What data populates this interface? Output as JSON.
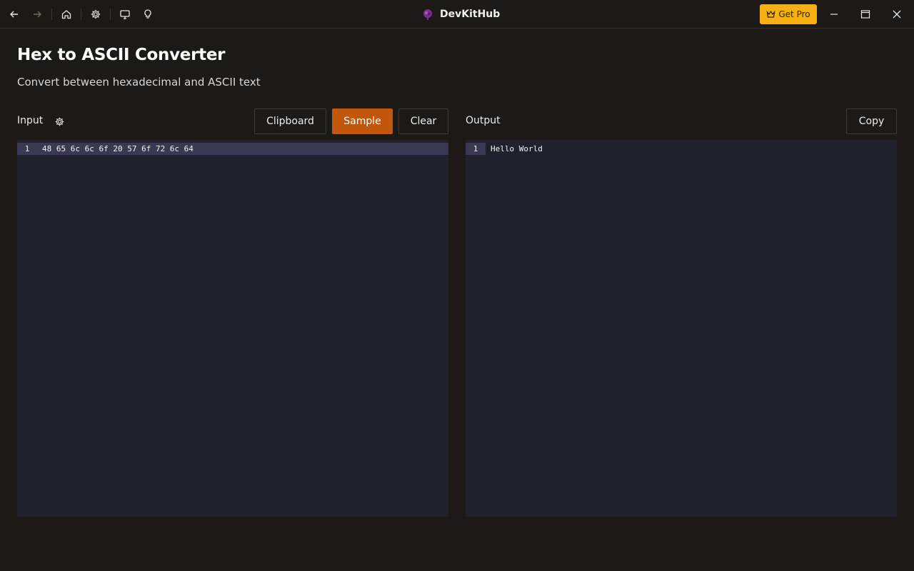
{
  "app": {
    "title": "DevKitHub",
    "get_pro_label": "Get Pro",
    "accent_color": "#f5b014"
  },
  "toolbar": {
    "icons": [
      "back-icon",
      "forward-icon",
      "home-icon",
      "settings-gear-icon",
      "monitor-icon",
      "lightbulb-icon"
    ]
  },
  "page": {
    "title": "Hex to ASCII Converter",
    "subtitle": "Convert between hexadecimal and ASCII text"
  },
  "input_panel": {
    "label": "Input",
    "buttons": {
      "clipboard": "Clipboard",
      "sample": "Sample",
      "clear": "Clear"
    },
    "lines": [
      {
        "number": "1",
        "text": "48 65 6c 6c 6f 20 57 6f 72 6c 64"
      }
    ]
  },
  "output_panel": {
    "label": "Output",
    "buttons": {
      "copy": "Copy"
    },
    "lines": [
      {
        "number": "1",
        "text": "Hello World"
      }
    ]
  },
  "colors": {
    "background": "#1c1917",
    "editor_bg": "#21202d",
    "active_line": "#3b3853",
    "primary_button": "#c2570c"
  }
}
